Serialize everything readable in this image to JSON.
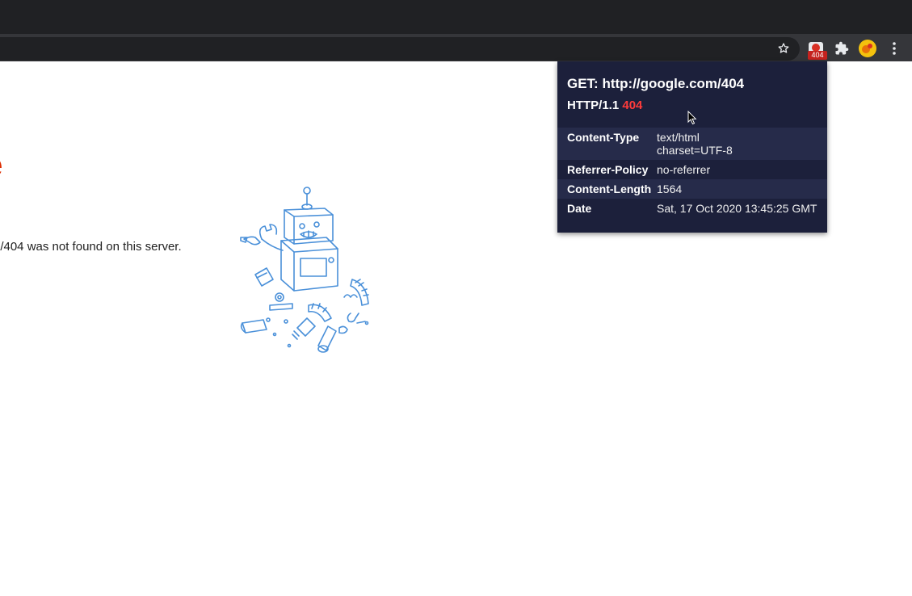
{
  "browser": {
    "extension_badge": "404"
  },
  "error_page": {
    "title_fragment": "e",
    "subtitle_fragment": ".",
    "message": ". /404 was not found on this server."
  },
  "popup": {
    "request_line": "GET: http://google.com/404",
    "protocol": "HTTP/1.1",
    "status_code": "404",
    "headers": [
      {
        "name": "Content-Type",
        "value": "text/html\ncharset=UTF-8"
      },
      {
        "name": "Referrer-Policy",
        "value": "no-referrer"
      },
      {
        "name": "Content-Length",
        "value": "1564"
      },
      {
        "name": "Date",
        "value": "Sat, 17 Oct 2020 13:45:25 GMT"
      }
    ]
  },
  "colors": {
    "popup_background": "#1c203b",
    "status_error": "#ff3b3b",
    "error_title": "#dd2c00"
  }
}
